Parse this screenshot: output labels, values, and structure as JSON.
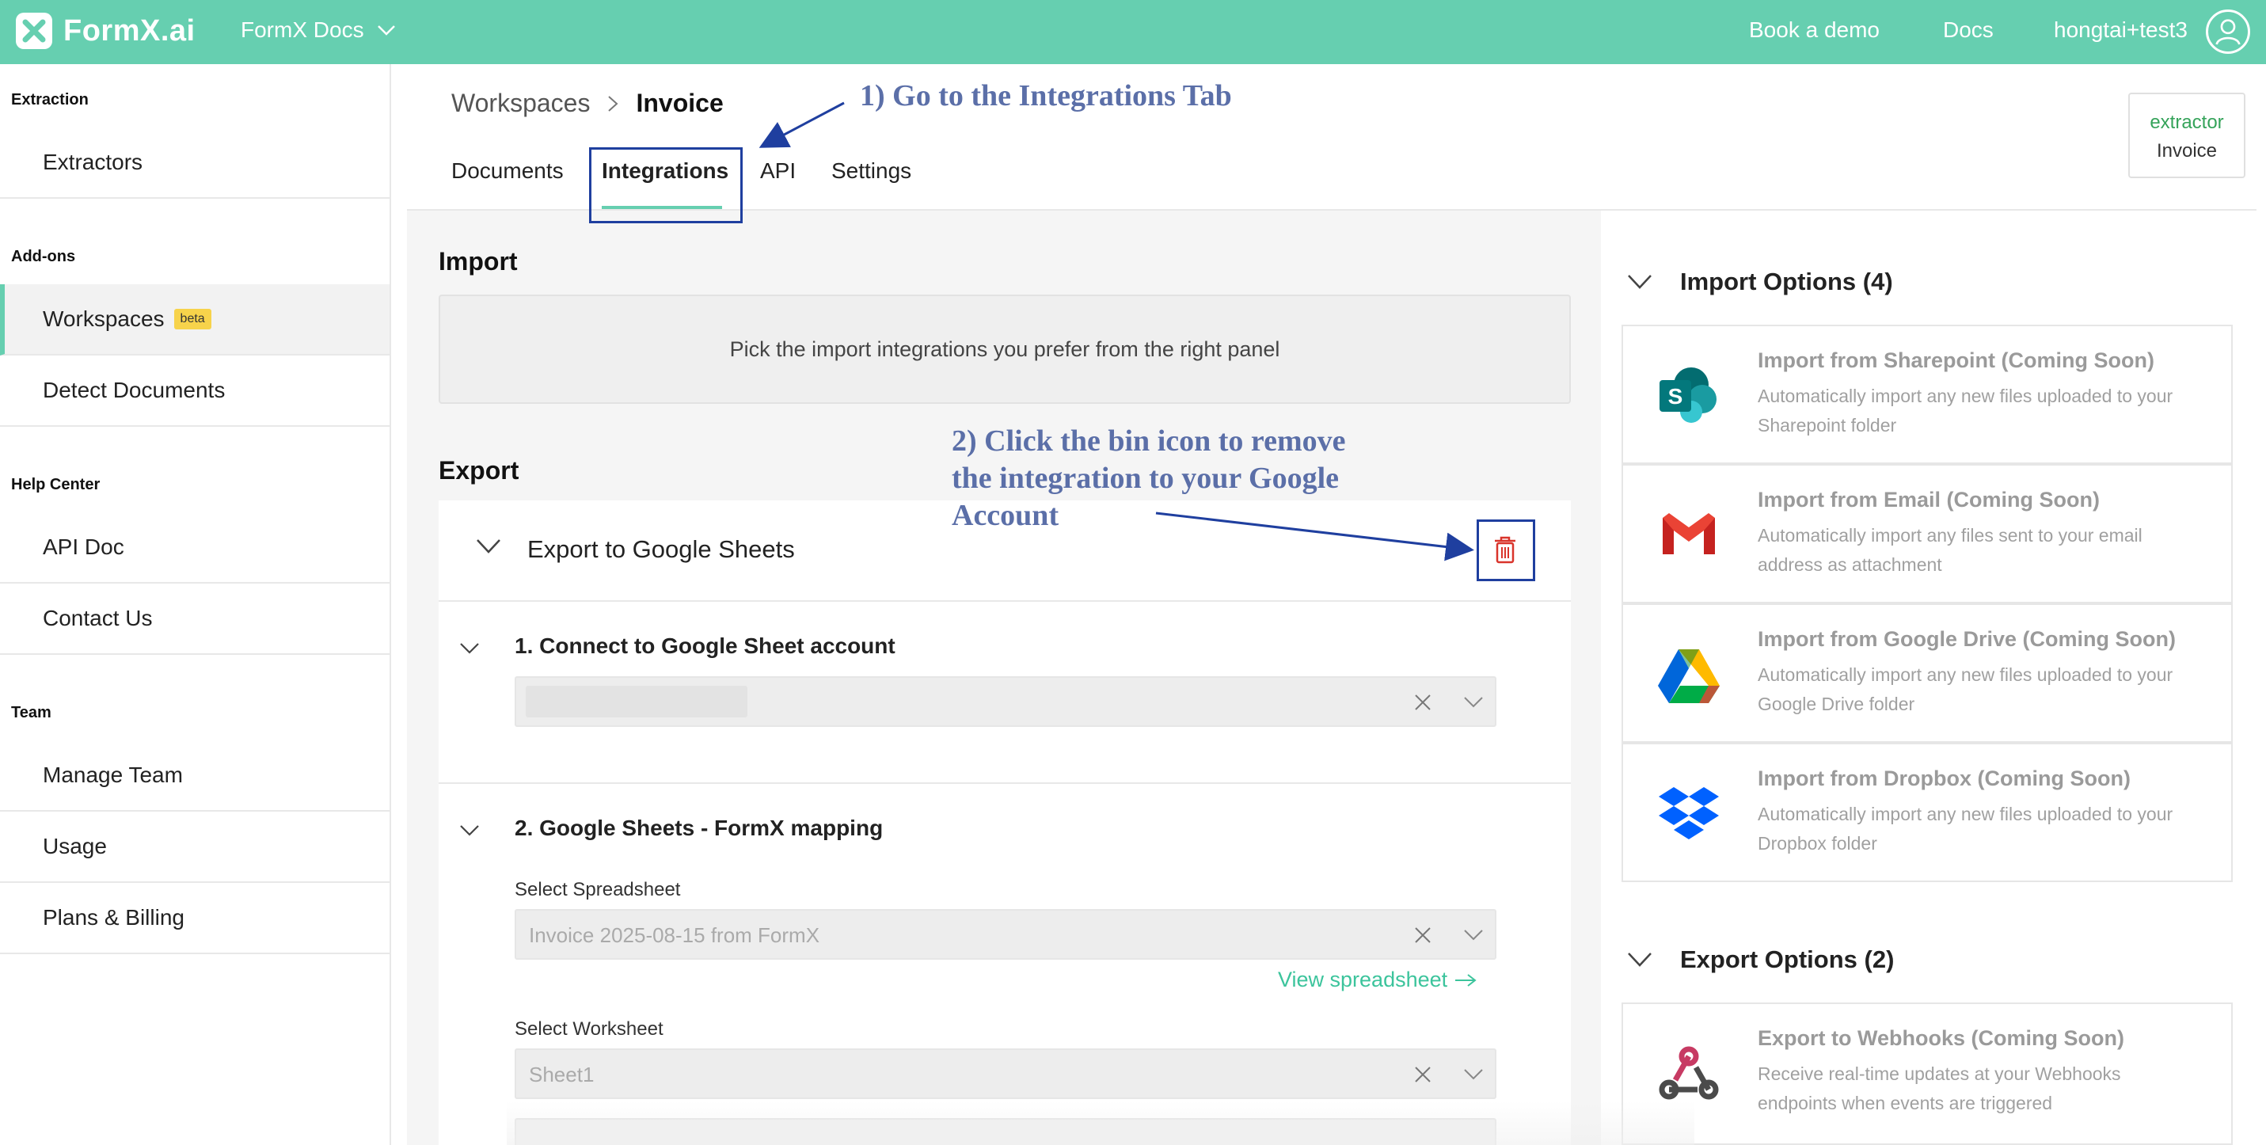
{
  "topbar": {
    "logo_text": "FormX.ai",
    "docs_label": "FormX Docs",
    "book_demo": "Book a demo",
    "docs_link": "Docs",
    "username": "hongtai+test3",
    "bg_color": "#66cfb0"
  },
  "sidebar": {
    "sections": [
      {
        "title": "Extraction",
        "items": [
          {
            "label": "Extractors"
          }
        ]
      },
      {
        "title": "Add-ons",
        "items": [
          {
            "label": "Workspaces",
            "badge": "beta",
            "active": true
          },
          {
            "label": "Detect Documents"
          }
        ]
      },
      {
        "title": "Help Center",
        "items": [
          {
            "label": "API Doc"
          },
          {
            "label": "Contact Us"
          }
        ]
      },
      {
        "title": "Team",
        "items": [
          {
            "label": "Manage Team"
          },
          {
            "label": "Usage"
          },
          {
            "label": "Plans & Billing"
          }
        ]
      }
    ]
  },
  "breadcrumb": {
    "root": "Workspaces",
    "current": "Invoice"
  },
  "tabs": [
    {
      "label": "Documents"
    },
    {
      "label": "Integrations",
      "active": true
    },
    {
      "label": "API"
    },
    {
      "label": "Settings"
    }
  ],
  "extractor_badge": {
    "label": "extractor",
    "value": "Invoice"
  },
  "import_section": {
    "heading": "Import",
    "placeholder": "Pick the import integrations you prefer from the right panel"
  },
  "export_section": {
    "heading": "Export",
    "card_title": "Export to Google Sheets",
    "step1": {
      "title": "1. Connect to Google Sheet account"
    },
    "step2": {
      "title": "2. Google Sheets - FormX mapping",
      "spreadsheet_label": "Select Spreadsheet",
      "spreadsheet_value": "Invoice 2025-08-15 from FormX",
      "view_link": "View spreadsheet",
      "worksheet_label": "Select Worksheet",
      "worksheet_value": "Sheet1"
    }
  },
  "import_options": {
    "title": "Import Options (4)",
    "items": [
      {
        "icon": "sharepoint-icon",
        "title": "Import from Sharepoint (Coming Soon)",
        "desc": "Automatically import any new files uploaded to your Sharepoint folder"
      },
      {
        "icon": "gmail-icon",
        "title": "Import from Email (Coming Soon)",
        "desc": "Automatically import any files sent to your email address as attachment"
      },
      {
        "icon": "google-drive-icon",
        "title": "Import from Google Drive (Coming Soon)",
        "desc": "Automatically import any new files uploaded to your Google Drive folder"
      },
      {
        "icon": "dropbox-icon",
        "title": "Import from Dropbox (Coming Soon)",
        "desc": "Automatically import any new files uploaded to your Dropbox folder"
      }
    ]
  },
  "export_options": {
    "title": "Export Options (2)",
    "items": [
      {
        "icon": "webhook-icon",
        "title": "Export to Webhooks (Coming Soon)",
        "desc": "Receive real-time updates at your Webhooks endpoints when events are triggered"
      }
    ]
  },
  "annotations": {
    "step1": "1) Go to the Integrations Tab",
    "step2_line1": "2) Click the bin icon to remove",
    "step2_line2": "the integration to your Google",
    "step2_line3": "Account",
    "color": "#1f3f9f"
  }
}
